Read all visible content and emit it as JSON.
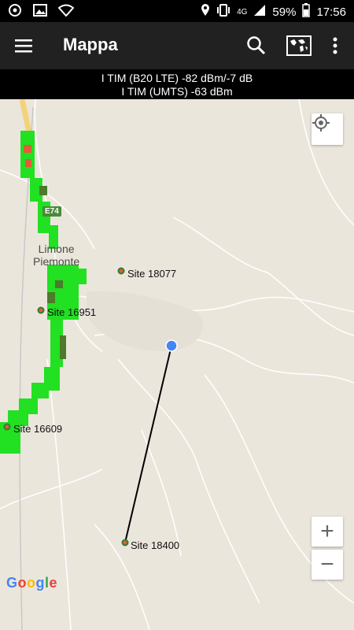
{
  "status_bar": {
    "network_badge": "4G",
    "battery": "59%",
    "time": "17:56"
  },
  "app_bar": {
    "title": "Mappa"
  },
  "info_bar": {
    "line1": "I TIM (B20 LTE) -82 dBm/-7 dB",
    "line2": "I TIM (UMTS) -63 dBm"
  },
  "map": {
    "town_line1": "Limone",
    "town_line2": "Piemonte",
    "road_badge": "E74",
    "sites": [
      {
        "label": "Site 18077"
      },
      {
        "label": "Site 16951"
      },
      {
        "label": "Site 16609"
      },
      {
        "label": "Site 18400"
      }
    ],
    "zoom_in": "+",
    "zoom_out": "−",
    "google_logo": "Google",
    "colors": {
      "signal_green": "#22e022",
      "signal_dark": "#4e7a2b",
      "signal_red": "#e65a3a",
      "location_blue": "#4285f4"
    }
  }
}
